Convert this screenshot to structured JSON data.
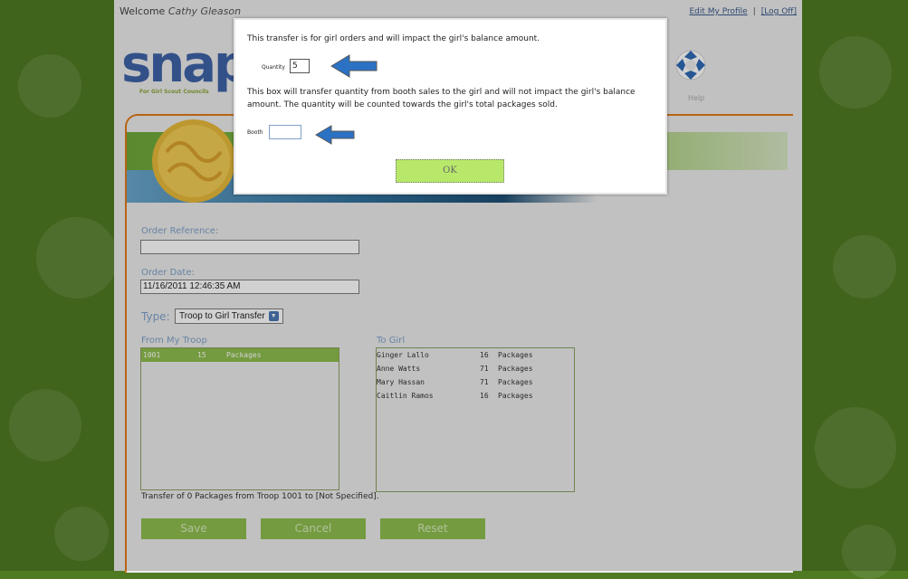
{
  "header": {
    "welcome": "Welcome",
    "user_name": "Cathy Gleason",
    "edit_profile": "Edit My Profile",
    "separator": "|",
    "log_off": "[Log Off]"
  },
  "logo": {
    "text": "snap",
    "subtitle": "For Girl Scout Councils"
  },
  "help": {
    "label": "Help"
  },
  "form": {
    "order_reference_label": "Order Reference:",
    "order_reference_value": "",
    "order_date_label": "Order Date:",
    "order_date_value": "11/16/2011 12:46:35 AM",
    "type_label": "Type:",
    "type_value": "Troop to Girl Transfer",
    "from_label": "From My Troop",
    "to_label": "To Girl",
    "from_items": [
      {
        "id": "1001",
        "qty": "15",
        "unit": "Packages"
      }
    ],
    "to_items": [
      {
        "name": "Ginger Lallo",
        "qty": "16",
        "unit": "Packages"
      },
      {
        "name": "Anne Watts",
        "qty": "71",
        "unit": "Packages"
      },
      {
        "name": "Mary Hassan",
        "qty": "71",
        "unit": "Packages"
      },
      {
        "name": "Caitlin Ramos",
        "qty": "16",
        "unit": "Packages"
      }
    ],
    "transfer_summary": "Transfer of 0 Packages from Troop 1001 to [Not Specified].",
    "buttons": {
      "save": "Save",
      "cancel": "Cancel",
      "reset": "Reset"
    }
  },
  "modal": {
    "text1": "This transfer is for girl orders and will impact the girl's balance amount.",
    "quantity_label": "Quantity",
    "quantity_value": "5",
    "text2": "This box will transfer quantity from booth sales to the girl and will not impact the girl's balance amount. The quantity will be counted towards the girl's total packages sold.",
    "booth_label": "Booth",
    "booth_value": "",
    "ok_label": "OK"
  },
  "colors": {
    "accent_green": "#8ebd4d",
    "ok_green": "#b8e86a",
    "arrow_blue": "#2b72c4",
    "panel_orange": "#e07b1a",
    "label_blue": "#7fa0c8"
  }
}
